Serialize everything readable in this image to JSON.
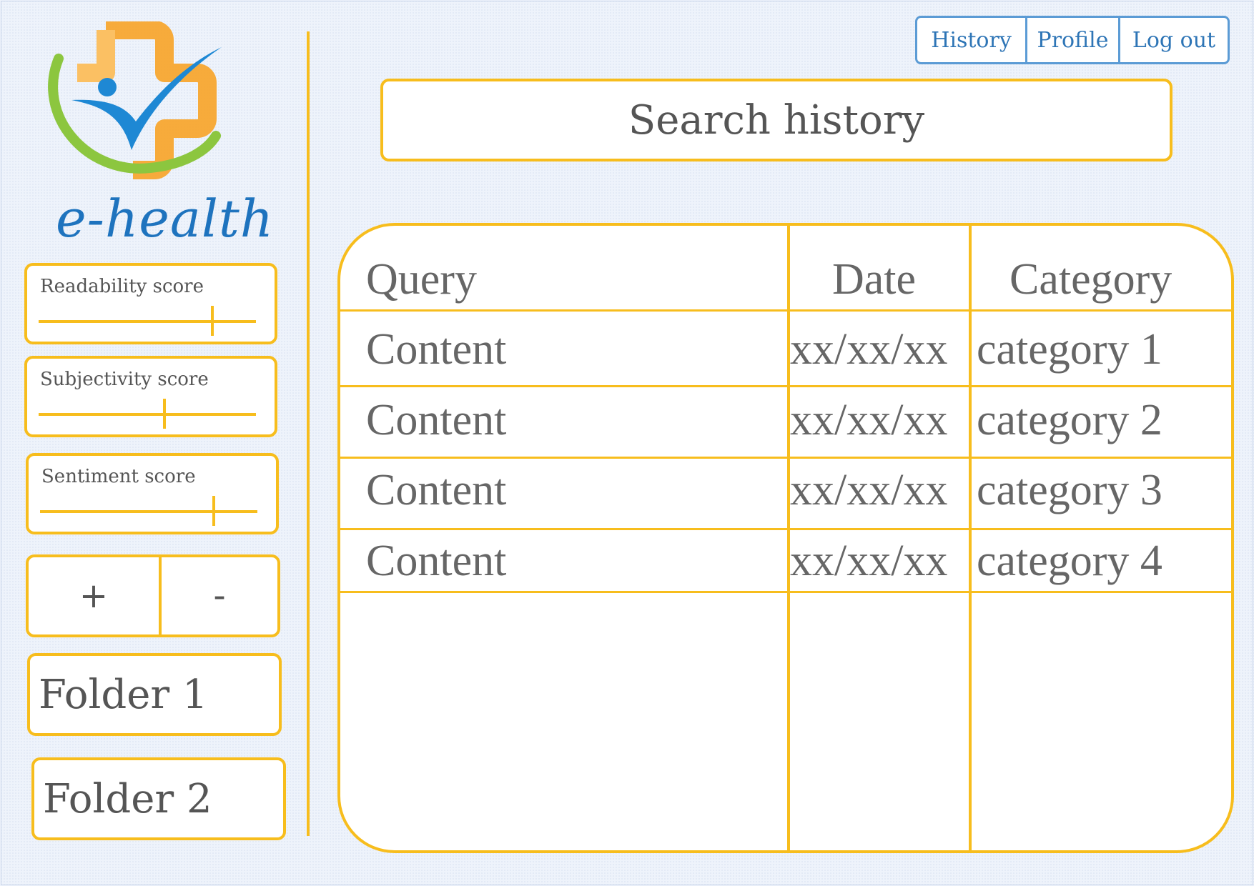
{
  "app": {
    "logo_text": "e-health"
  },
  "nav": {
    "history": "History",
    "profile": "Profile",
    "logout": "Log out"
  },
  "search": {
    "placeholder": "Search history"
  },
  "sidebar": {
    "sliders": [
      {
        "label": "Readability score",
        "value_percent": 80
      },
      {
        "label": "Subjectivity score",
        "value_percent": 58
      },
      {
        "label": "Sentiment score",
        "value_percent": 80
      }
    ],
    "zoom_in": "+",
    "zoom_out": "-",
    "folders": [
      "Folder 1",
      "Folder 2"
    ]
  },
  "table": {
    "headers": {
      "query": "Query",
      "date": "Date",
      "category": "Category"
    },
    "rows": [
      {
        "query": "Content",
        "date": "xx/xx/xx",
        "category": "category 1"
      },
      {
        "query": "Content",
        "date": "xx/xx/xx",
        "category": "category 2"
      },
      {
        "query": "Content",
        "date": "xx/xx/xx",
        "category": "category 3"
      },
      {
        "query": "Content",
        "date": "xx/xx/xx",
        "category": "category 4"
      }
    ]
  },
  "colors": {
    "accent_yellow": "#f7bd1d",
    "nav_blue": "#5b9bd5",
    "logo_blue": "#1e73be",
    "logo_green": "#8cc63f",
    "logo_orange": "#f7a630"
  }
}
